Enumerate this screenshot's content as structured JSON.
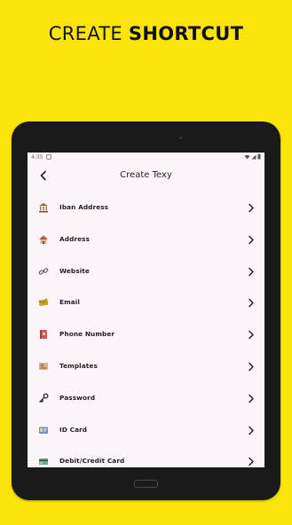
{
  "promo": {
    "light": "CREATE",
    "bold": "SHORTCUT"
  },
  "status": {
    "time": "4:35"
  },
  "header": {
    "title": "Create Texy"
  },
  "items": [
    {
      "label": "Iban Address",
      "icon": "bank-icon"
    },
    {
      "label": "Address",
      "icon": "house-icon"
    },
    {
      "label": "Website",
      "icon": "link-icon"
    },
    {
      "label": "Email",
      "icon": "envelope-icon"
    },
    {
      "label": "Phone Number",
      "icon": "phone-book-icon"
    },
    {
      "label": "Templates",
      "icon": "template-icon"
    },
    {
      "label": "Password",
      "icon": "key-icon"
    },
    {
      "label": "ID Card",
      "icon": "id-card-icon"
    },
    {
      "label": "Debit/Credit Card",
      "icon": "credit-card-icon"
    }
  ],
  "colors": {
    "background": "#fbe40a",
    "screen": "#fbf4f8",
    "device": "#1a1a1a"
  }
}
